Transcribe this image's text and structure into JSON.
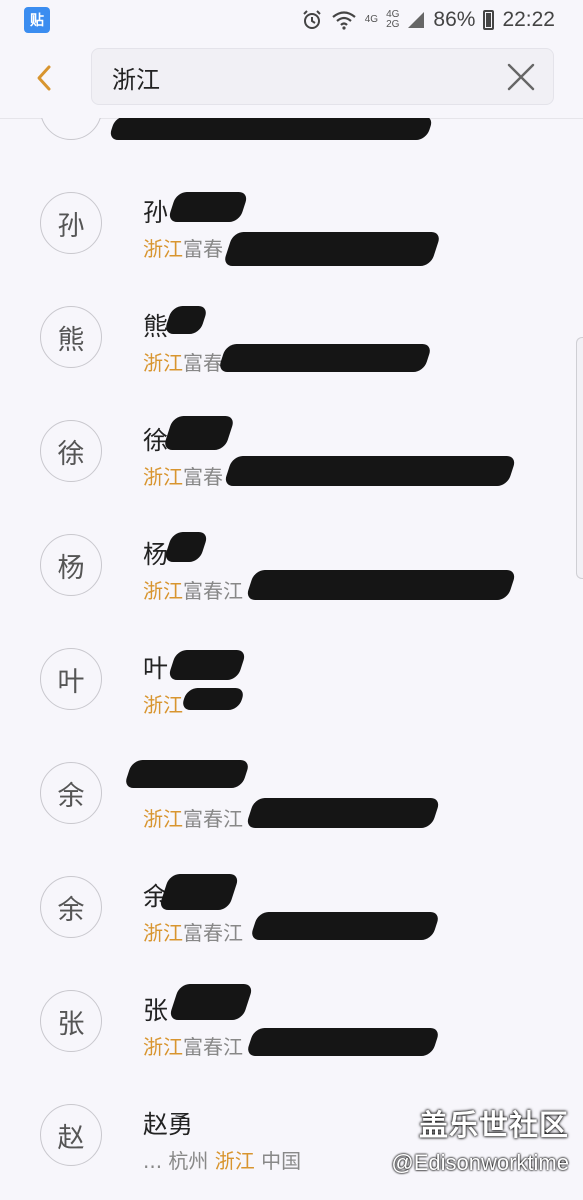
{
  "status_bar": {
    "app_badge": "贴",
    "network_top": "4G",
    "network_mid_top": "4G",
    "network_mid_bottom": "2G",
    "battery": "86%",
    "time": "22:22"
  },
  "search": {
    "query": "浙江"
  },
  "rows": [
    {
      "avatar": "孙",
      "name": "孙",
      "detail_hl": "浙江",
      "detail_rest": "富春"
    },
    {
      "avatar": "熊",
      "name": "熊",
      "detail_hl": "浙江",
      "detail_rest": "富春"
    },
    {
      "avatar": "徐",
      "name": "徐",
      "detail_hl": "浙江",
      "detail_rest": "富春"
    },
    {
      "avatar": "杨",
      "name": "杨",
      "detail_hl": "浙江",
      "detail_rest": "富春江"
    },
    {
      "avatar": "叶",
      "name": "叶",
      "detail_hl": "浙江",
      "detail_rest": ""
    },
    {
      "avatar": "余",
      "name": "",
      "detail_hl": "浙江",
      "detail_rest": "富春江"
    },
    {
      "avatar": "余",
      "name": "余",
      "detail_hl": "浙江",
      "detail_rest": "富春江"
    },
    {
      "avatar": "张",
      "name": "张",
      "detail_hl": "浙江",
      "detail_rest": "富春江"
    },
    {
      "avatar": "赵",
      "name": "赵勇",
      "detail_prefix": "... 杭州 ",
      "detail_hl": "浙江",
      "detail_rest": " 中国"
    }
  ],
  "watermark": {
    "title": "盖乐世社区",
    "author": "@Edisonworktime"
  }
}
